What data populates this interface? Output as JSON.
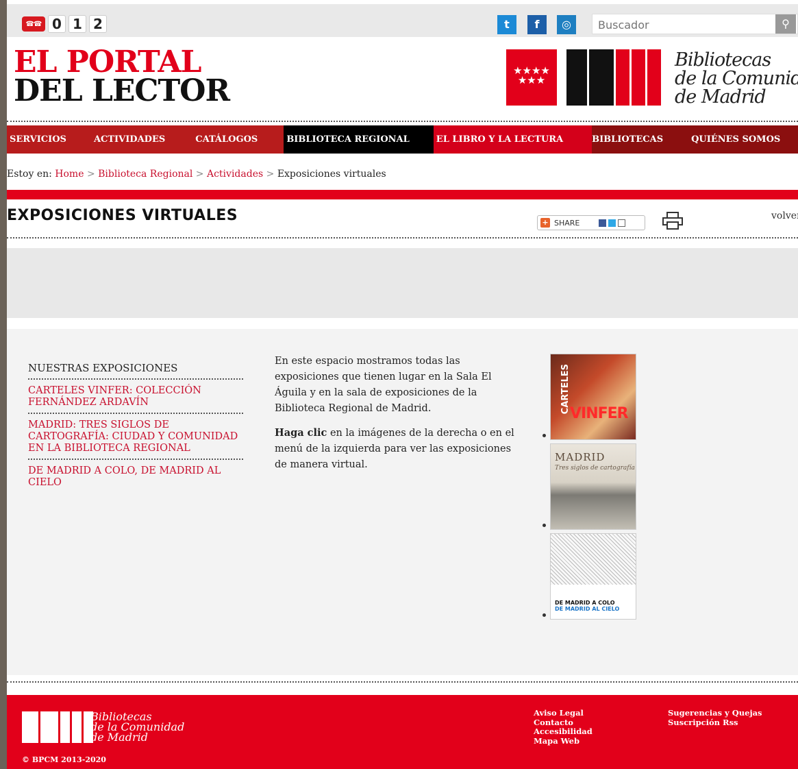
{
  "topbar": {
    "phone_digits": [
      "0",
      "1",
      "2"
    ],
    "social": {
      "twitter": "t",
      "facebook": "f",
      "instagram": "◎"
    },
    "search": {
      "placeholder": "Buscador",
      "button_glyph": "⚲"
    }
  },
  "brand": {
    "line1": "EL PORTAL",
    "line2": "DEL LECTOR"
  },
  "bcm_logo": {
    "stars": "★★★★\n★★★",
    "line1": "Bibliotecas",
    "line2": "de la Comunidad",
    "line3": "de Madrid"
  },
  "nav": [
    {
      "label": "SERVICIOS"
    },
    {
      "label": "ACTIVIDADES"
    },
    {
      "label": "CATÁLOGOS"
    },
    {
      "label": "BIBLIOTECA REGIONAL"
    },
    {
      "label": "EL LIBRO Y LA LECTURA"
    },
    {
      "label": "BIBLIOTECAS"
    },
    {
      "label": "QUIÉNES SOMOS"
    }
  ],
  "breadcrumb": {
    "prefix": "Estoy en:",
    "items": [
      "Home",
      "Biblioteca Regional",
      "Actividades"
    ],
    "current": "Exposiciones virtuales"
  },
  "page": {
    "title": "EXPOSICIONES VIRTUALES",
    "share_label": "SHARE",
    "volver": "volver"
  },
  "sidebar": {
    "heading": "NUESTRAS EXPOSICIONES",
    "links": [
      "CARTELES VINFER: COLECCIÓN FERNÁNDEZ ARDAVÍN",
      "MADRID: TRES SIGLOS DE CARTOGRAFÍA: CIUDAD Y COMUNIDAD EN LA BIBLIOTECA REGIONAL",
      "DE MADRID A COLO, DE MADRID AL CIELO"
    ]
  },
  "intro": {
    "p1": "En este espacio mostramos todas las exposiciones que tienen lugar en la Sala El Águila y en la sala de exposiciones de la Biblioteca Regional de Madrid.",
    "p2_bold": "Haga clic",
    "p2_rest": " en la imágenes de la derecha o en el menú de la izquierda para ver las exposiciones de manera virtual."
  },
  "thumbs": {
    "t1_vertical": "CARTELES",
    "t1_big": "VINFER",
    "t2_title": "MADRID",
    "t2_sub": "Tres siglos de cartografía",
    "t3_line1": "DE MADRID A COLO",
    "t3_line2": "DE MADRID AL CIELO"
  },
  "footer": {
    "logo_line1": "Bibliotecas",
    "logo_line2": "de la Comunidad",
    "logo_line3": "de Madrid",
    "copyright": "© BPCM 2013-2020",
    "links_col1": [
      "Aviso Legal",
      "Contacto",
      "Accesibilidad",
      "Mapa Web"
    ],
    "links_col2": [
      "Sugerencias y Quejas",
      "Suscripción Rss"
    ]
  },
  "colors": {
    "brand_red": "#e2001a",
    "nav_dark_red": "#8b0f0f",
    "link_red": "#c8102e"
  }
}
